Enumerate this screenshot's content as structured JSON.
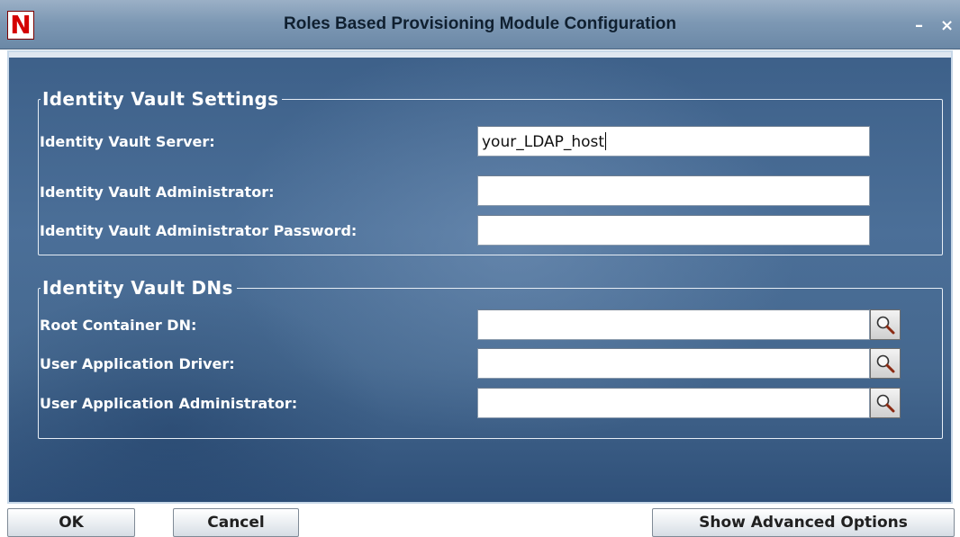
{
  "window": {
    "title": "Roles Based Provisioning Module Configuration",
    "logo_letter": "N",
    "minimize_glyph": "–",
    "close_glyph": "×"
  },
  "identity_vault_settings": {
    "legend": "Identity Vault Settings",
    "server": {
      "label": "Identity Vault Server:",
      "value": "your_LDAP_host"
    },
    "administrator": {
      "label": "Identity Vault Administrator:",
      "value": ""
    },
    "admin_password": {
      "label": "Identity Vault Administrator Password:",
      "value": ""
    }
  },
  "identity_vault_dns": {
    "legend": "Identity Vault DNs",
    "root_container": {
      "label": "Root Container DN:",
      "value": ""
    },
    "user_app_driver": {
      "label": "User Application Driver:",
      "value": ""
    },
    "user_app_admin": {
      "label": "User Application Administrator:",
      "value": ""
    }
  },
  "buttons": {
    "ok": "OK",
    "cancel": "Cancel",
    "show_advanced": "Show Advanced Options"
  },
  "icons": {
    "browse": "magnifier-icon"
  }
}
